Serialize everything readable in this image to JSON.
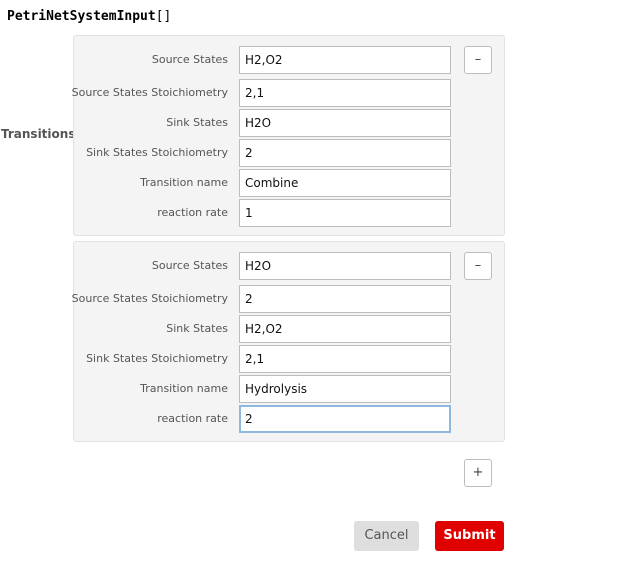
{
  "header": {
    "function_name": "PetriNetSystemInput",
    "brackets": "[]"
  },
  "section_label": "Transitions",
  "transitions": [
    {
      "fields": [
        {
          "label": "Source States",
          "value": "H2,O2"
        },
        {
          "label": "Source States Stoichiometry",
          "value": "2,1"
        },
        {
          "label": "Sink States",
          "value": "H2O"
        },
        {
          "label": "Sink States Stoichiometry",
          "value": "2"
        },
        {
          "label": "Transition name",
          "value": "Combine"
        },
        {
          "label": "reaction rate",
          "value": "1"
        }
      ],
      "remove_label": "–"
    },
    {
      "fields": [
        {
          "label": "Source States",
          "value": "H2O"
        },
        {
          "label": "Source States Stoichiometry",
          "value": "2"
        },
        {
          "label": "Sink States",
          "value": "H2,O2"
        },
        {
          "label": "Sink States Stoichiometry",
          "value": "2,1"
        },
        {
          "label": "Transition name",
          "value": "Hydrolysis"
        },
        {
          "label": "reaction rate",
          "value": "2"
        }
      ],
      "remove_label": "–"
    }
  ],
  "add_label": "+",
  "buttons": {
    "cancel": "Cancel",
    "submit": "Submit"
  },
  "icons": {
    "remove": "minus-icon",
    "add": "plus-icon"
  },
  "colors": {
    "submit": "#e00000",
    "focus_border": "#8fb8e0",
    "panel_bg": "#f4f4f4"
  }
}
